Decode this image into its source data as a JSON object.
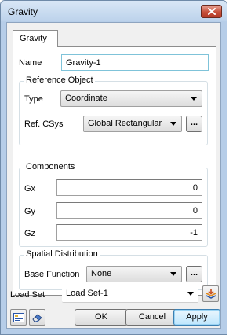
{
  "window": {
    "title": "Gravity"
  },
  "tab": {
    "label": "Gravity"
  },
  "name": {
    "label": "Name",
    "value": "Gravity-1"
  },
  "reference_object": {
    "title": "Reference Object",
    "type_label": "Type",
    "type_value": "Coordinate",
    "csys_label": "Ref. CSys",
    "csys_value": "Global Rectangular",
    "browse_label": "..."
  },
  "components": {
    "title": "Components",
    "gx_label": "Gx",
    "gx_value": "0",
    "gy_label": "Gy",
    "gy_value": "0",
    "gz_label": "Gz",
    "gz_value": "-1"
  },
  "spatial": {
    "title": "Spatial Distribution",
    "base_label": "Base Function",
    "base_value": "None",
    "browse_label": "..."
  },
  "load_set": {
    "label": "Load Set",
    "value": "Load Set-1"
  },
  "buttons": {
    "ok": "OK",
    "cancel": "Cancel",
    "apply": "Apply"
  },
  "icons": {
    "close": "close-icon",
    "chevron": "chevron-down-icon",
    "load_set_manager": "layers-arrow-icon",
    "settings_panel": "panel-icon",
    "eraser": "eraser-icon"
  }
}
